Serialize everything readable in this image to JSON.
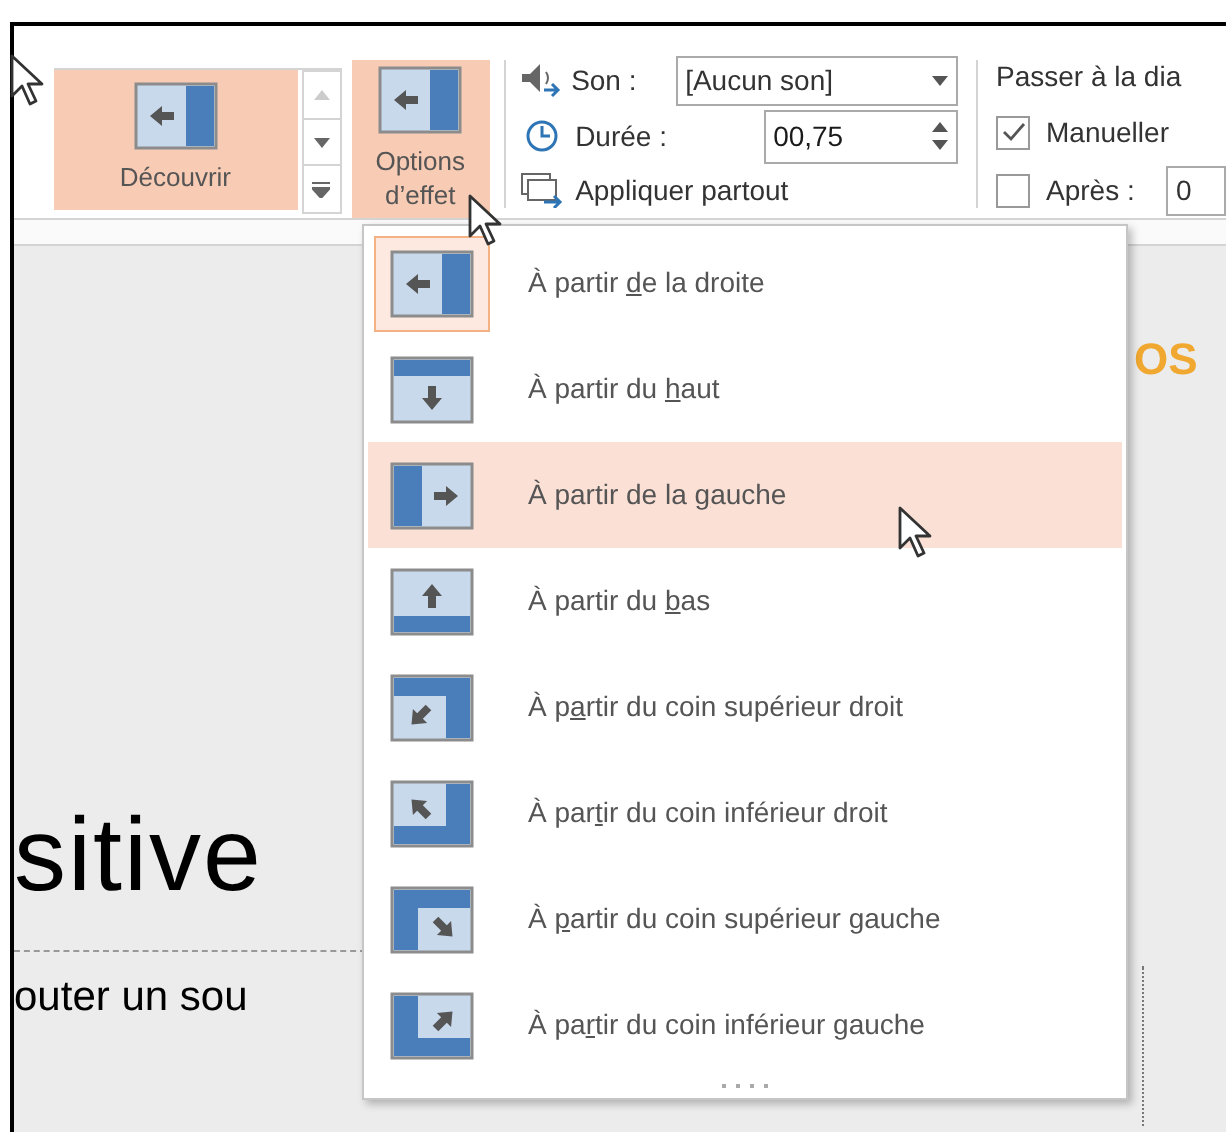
{
  "ribbon": {
    "gallery": {
      "label": "Découvrir",
      "selected": true
    },
    "effect_options": {
      "label_lines": [
        "Options",
        "d’effet"
      ],
      "selected": true
    },
    "sound": {
      "label": "Son :",
      "value": "[Aucun son]"
    },
    "duration": {
      "label": "Durée :",
      "value": "00,75"
    },
    "apply_all": {
      "label": "Appliquer partout"
    },
    "advance": {
      "title": "Passer à la dia",
      "on_click": {
        "label": "Manueller",
        "checked": true
      },
      "after": {
        "label": "Après :",
        "checked": false,
        "value": "0"
      }
    }
  },
  "slide": {
    "corner_text": "OS",
    "title": "sitive",
    "subtitle": "outer un sou"
  },
  "menu": {
    "items": [
      {
        "kind": "right",
        "pre": "À partir ",
        "key": "d",
        "post": "e la droite",
        "selected": true,
        "hovered": false
      },
      {
        "kind": "top",
        "pre": "À partir du ",
        "key": "h",
        "post": "aut",
        "selected": false,
        "hovered": false
      },
      {
        "kind": "left",
        "pre": "À partir de la ",
        "key": "g",
        "post": "auche",
        "selected": false,
        "hovered": true
      },
      {
        "kind": "bottom",
        "pre": "À partir du ",
        "key": "b",
        "post": "as",
        "selected": false,
        "hovered": false
      },
      {
        "kind": "top-right",
        "pre": "À p",
        "key": "a",
        "post": "rtir du coin supérieur droit",
        "selected": false,
        "hovered": false
      },
      {
        "kind": "bottom-right",
        "pre": "À par",
        "key": "t",
        "post": "ir du coin inférieur droit",
        "selected": false,
        "hovered": false
      },
      {
        "kind": "top-left",
        "pre": "À ",
        "key": "p",
        "post": "artir du coin supérieur gauche",
        "selected": false,
        "hovered": false
      },
      {
        "kind": "bottom-left",
        "pre": "À pa",
        "key": "r",
        "post": "tir du coin inférieur gauche",
        "selected": false,
        "hovered": false
      }
    ]
  }
}
